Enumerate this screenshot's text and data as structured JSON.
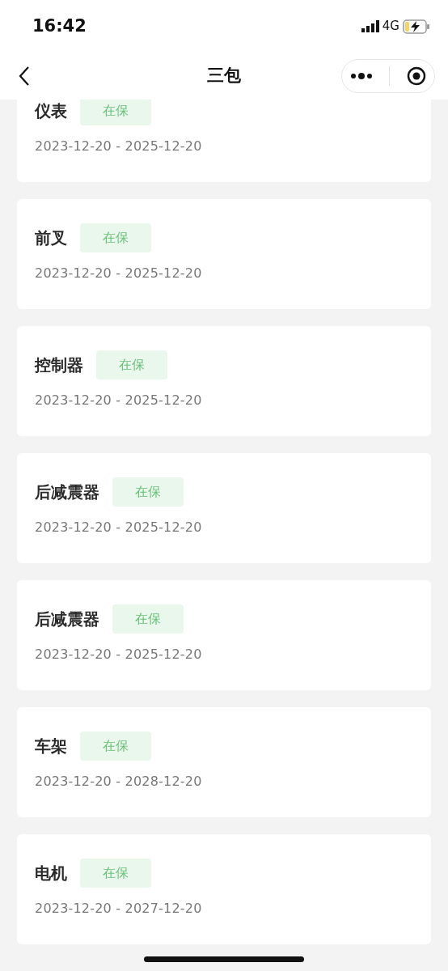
{
  "status_bar": {
    "time": "16:42",
    "network": "4G"
  },
  "nav": {
    "title": "三包"
  },
  "items": [
    {
      "name": "仪表",
      "status": "在保",
      "period": "2023-12-20 - 2025-12-20"
    },
    {
      "name": "前叉",
      "status": "在保",
      "period": "2023-12-20 - 2025-12-20"
    },
    {
      "name": "控制器",
      "status": "在保",
      "period": "2023-12-20 - 2025-12-20"
    },
    {
      "name": "后减震器",
      "status": "在保",
      "period": "2023-12-20 - 2025-12-20"
    },
    {
      "name": "后减震器",
      "status": "在保",
      "period": "2023-12-20 - 2025-12-20"
    },
    {
      "name": "车架",
      "status": "在保",
      "period": "2023-12-20 - 2028-12-20"
    },
    {
      "name": "电机",
      "status": "在保",
      "period": "2023-12-20 - 2027-12-20"
    }
  ]
}
